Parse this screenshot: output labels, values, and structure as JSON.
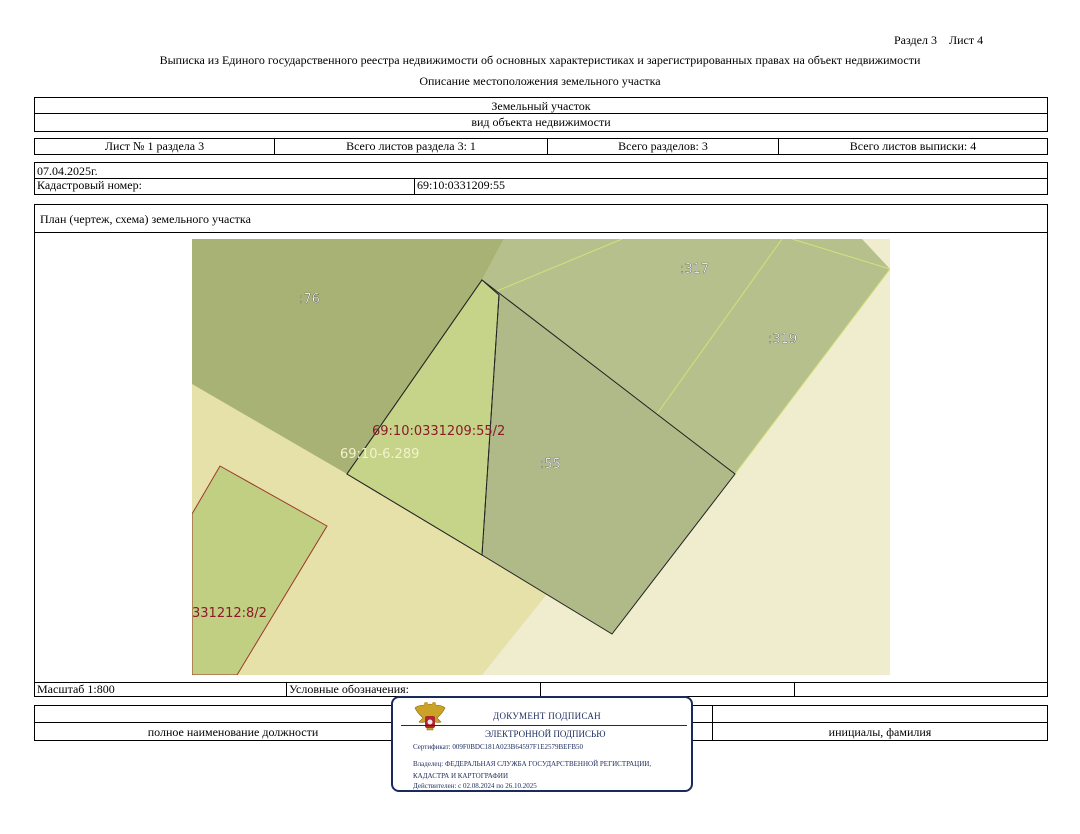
{
  "header": {
    "section_sheet": "Раздел 3    Лист 4",
    "title": "Выписка из Единого государственного реестра недвижимости об основных характеристиках и зарегистрированных правах на объект недвижимости",
    "subtitle": "Описание местоположения земельного участка"
  },
  "object": {
    "type": "Земельный участок",
    "type_caption": "вид объекта недвижимости"
  },
  "sheets": {
    "sheet_of_section": "Лист № 1 раздела 3",
    "total_section_sheets": "Всего листов раздела 3: 1",
    "total_sections": "Всего разделов: 3",
    "total_extract_sheets": "Всего листов выписки: 4"
  },
  "date": "07.04.2025г.",
  "cadastral": {
    "label": "Кадастровый номер:",
    "value": "69:10:0331209:55"
  },
  "plan": {
    "heading": "План (чертеж, схема) земельного участка",
    "labels": {
      "p76": ":76",
      "p317": ":317",
      "p319": ":319",
      "p55": ":55",
      "part": "69:10:0331209:55/2",
      "zone": "69:10-6.289",
      "left": "331212:8/2"
    },
    "colors": {
      "background": "#efedce",
      "road": "#e6e1a8",
      "parcel_dark": "#a7b274",
      "parcel_mid": "#b5c08c",
      "parcel_main": "#b0ba88",
      "part_fill": "#c5d488",
      "part_text": "#8b1a2a",
      "zone_text": "#f4f2cc"
    }
  },
  "scale": "Масштаб 1:800",
  "legend_label": "Условные обозначения:",
  "signature": {
    "position_caption": "полное наименование должности",
    "name_caption": "инициалы, фамилия"
  },
  "stamp": {
    "line1": "ДОКУМЕНТ ПОДПИСАН",
    "line2": "ЭЛЕКТРОННОЙ ПОДПИСЬЮ",
    "certificate": "Сертификат: 009F0BDC181A023B64597F1E2579BEFB50",
    "owner": "Владелец: ФЕДЕРАЛЬНАЯ СЛУЖБА ГОСУДАРСТВЕННОЙ РЕГИСТРАЦИИ, КАДАСТРА И КАРТОГРАФИИ",
    "valid": "Действителен: с 02.08.2024 по 26.10.2025",
    "emblem": "eagle-emblem-icon",
    "border_color": "#1a2a5c"
  }
}
